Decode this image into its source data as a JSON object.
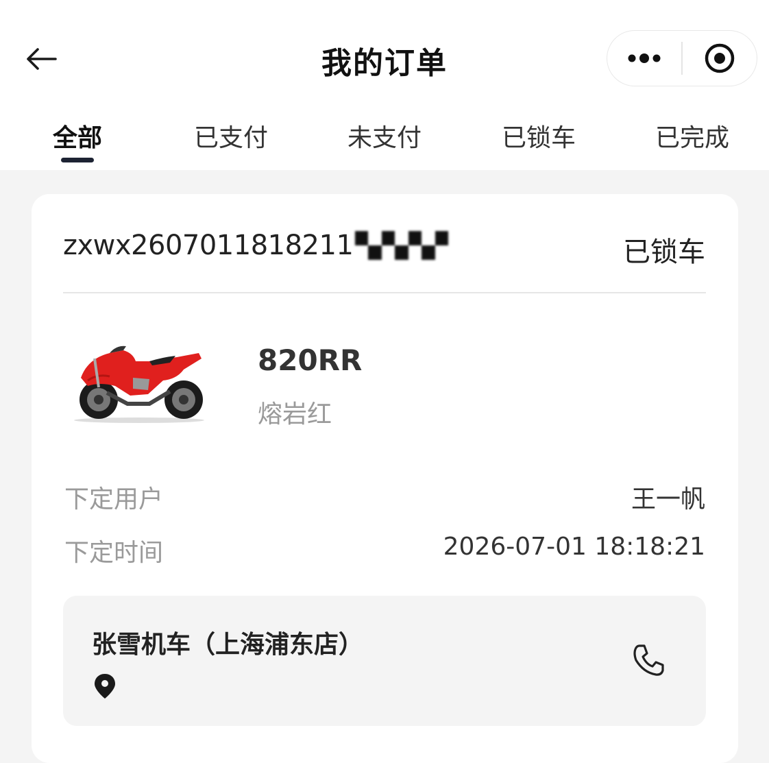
{
  "header": {
    "title": "我的订单"
  },
  "tabs": [
    {
      "label": "全部",
      "active": true
    },
    {
      "label": "已支付",
      "active": false
    },
    {
      "label": "未支付",
      "active": false
    },
    {
      "label": "已锁车",
      "active": false
    },
    {
      "label": "已完成",
      "active": false
    }
  ],
  "order": {
    "number_visible": "zxwx2607011818211",
    "status": "已锁车",
    "product": {
      "model": "820RR",
      "color": "熔岩红",
      "image_icon": "red-motorcycle-image"
    },
    "details": [
      {
        "label": "下定用户",
        "value": "王一帆"
      },
      {
        "label": "下定时间",
        "value": "2026-07-01 18:18:21"
      }
    ],
    "store": {
      "name": "张雪机车（上海浦东店）",
      "pin_icon": "location-pin-icon",
      "phone_icon": "phone-icon"
    }
  },
  "colors": {
    "tab_underline": "#1d2333",
    "motorcycle_red": "#e0201e",
    "muted_text": "#9a9a9a"
  }
}
